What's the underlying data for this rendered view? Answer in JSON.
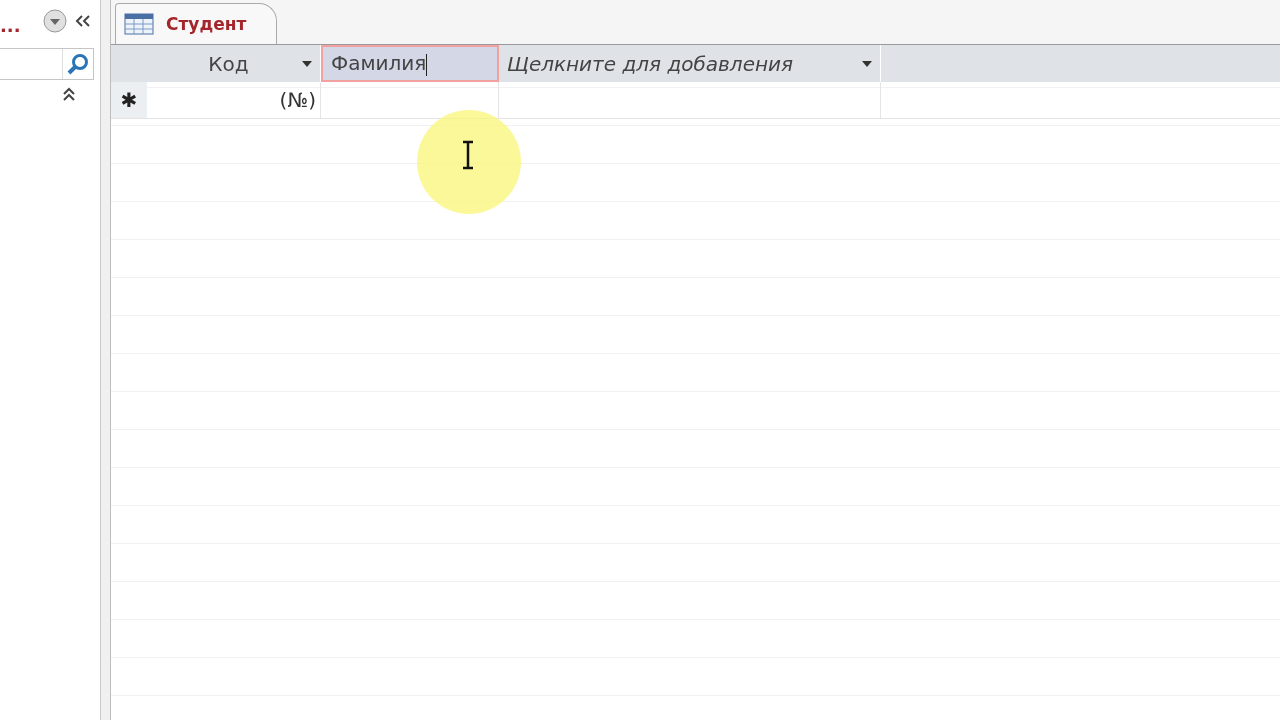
{
  "navigation_pane": {
    "title": "..."
  },
  "tab": {
    "title": "Студент",
    "selected": true
  },
  "table": {
    "columns": [
      {
        "label": "Код",
        "kind": "field",
        "editing": false
      },
      {
        "label": "Фамилия",
        "kind": "field",
        "editing": true
      },
      {
        "label": "Щелкните для добавления",
        "kind": "add",
        "editing": false
      }
    ],
    "new_row": {
      "marker": "✱",
      "cells": [
        "(№)"
      ]
    }
  }
}
